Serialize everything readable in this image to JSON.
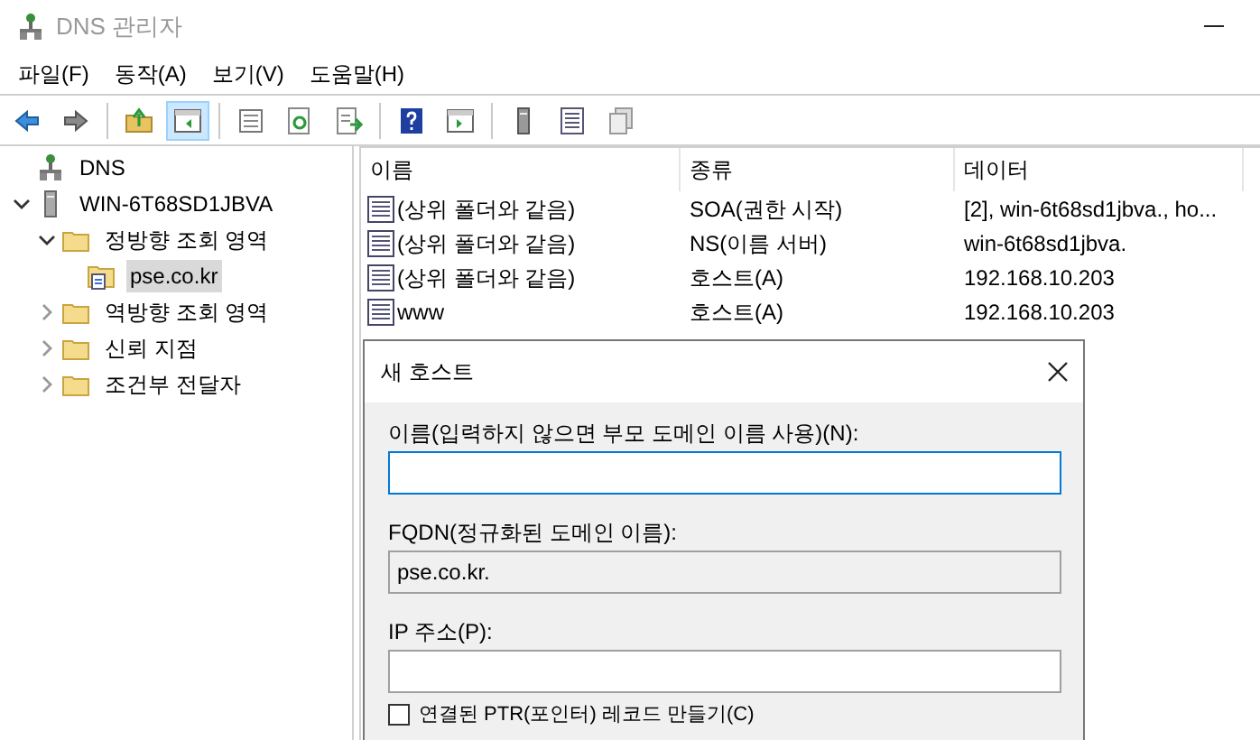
{
  "window": {
    "title": "DNS 관리자"
  },
  "menu": [
    {
      "label": "파일(F)"
    },
    {
      "label": "동작(A)"
    },
    {
      "label": "보기(V)"
    },
    {
      "label": "도움말(H)"
    }
  ],
  "toolbar": [
    {
      "kind": "back",
      "selected": false
    },
    {
      "kind": "forward",
      "selected": false
    },
    {
      "kind": "sep"
    },
    {
      "kind": "up",
      "selected": false
    },
    {
      "kind": "tree",
      "selected": true
    },
    {
      "kind": "sep"
    },
    {
      "kind": "props",
      "selected": false
    },
    {
      "kind": "refresh",
      "selected": false
    },
    {
      "kind": "export",
      "selected": false
    },
    {
      "kind": "sep"
    },
    {
      "kind": "help",
      "selected": false
    },
    {
      "kind": "pane",
      "selected": false
    },
    {
      "kind": "sep"
    },
    {
      "kind": "server",
      "selected": false
    },
    {
      "kind": "list",
      "selected": false
    },
    {
      "kind": "copy",
      "selected": false
    }
  ],
  "tree": [
    {
      "label": "DNS",
      "kind": "root",
      "selected": false,
      "children": [
        {
          "label": "WIN-6T68SD1JBVA",
          "kind": "server",
          "selected": false,
          "expanded": true,
          "children": [
            {
              "label": "정방향 조회 영역",
              "kind": "folder",
              "selected": false,
              "expanded": true,
              "children": [
                {
                  "label": "pse.co.kr",
                  "kind": "zone",
                  "selected": true
                }
              ]
            },
            {
              "label": "역방향 조회 영역",
              "kind": "folder",
              "selected": false,
              "expanded": false
            },
            {
              "label": "신뢰 지점",
              "kind": "folder",
              "selected": false,
              "expanded": false
            },
            {
              "label": "조건부 전달자",
              "kind": "folder",
              "selected": false,
              "expanded": false
            }
          ]
        }
      ]
    }
  ],
  "table": {
    "columns": [
      "이름",
      "종류",
      "데이터"
    ],
    "rows": [
      {
        "name": "(상위 폴더와 같음)",
        "type": "SOA(권한 시작)",
        "data": "[2], win-6t68sd1jbva., ho..."
      },
      {
        "name": "(상위 폴더와 같음)",
        "type": "NS(이름 서버)",
        "data": "win-6t68sd1jbva."
      },
      {
        "name": "(상위 폴더와 같음)",
        "type": "호스트(A)",
        "data": "192.168.10.203"
      },
      {
        "name": "www",
        "type": "호스트(A)",
        "data": "192.168.10.203"
      }
    ]
  },
  "dialog": {
    "title": "새 호스트",
    "fields": [
      {
        "label": "이름(입력하지 않으면 부모 도메인 이름 사용)(N):",
        "kind": "input",
        "focused": true
      },
      {
        "label": "FQDN(정규화된 도메인 이름):",
        "kind": "readonly",
        "value": "pse.co.kr.",
        "focused": false
      },
      {
        "label": "IP 주소(P):",
        "kind": "input",
        "focused": false
      }
    ],
    "checkbox": {
      "label": "연결된 PTR(포인터) 레코드 만들기(C)",
      "checked": false
    }
  }
}
